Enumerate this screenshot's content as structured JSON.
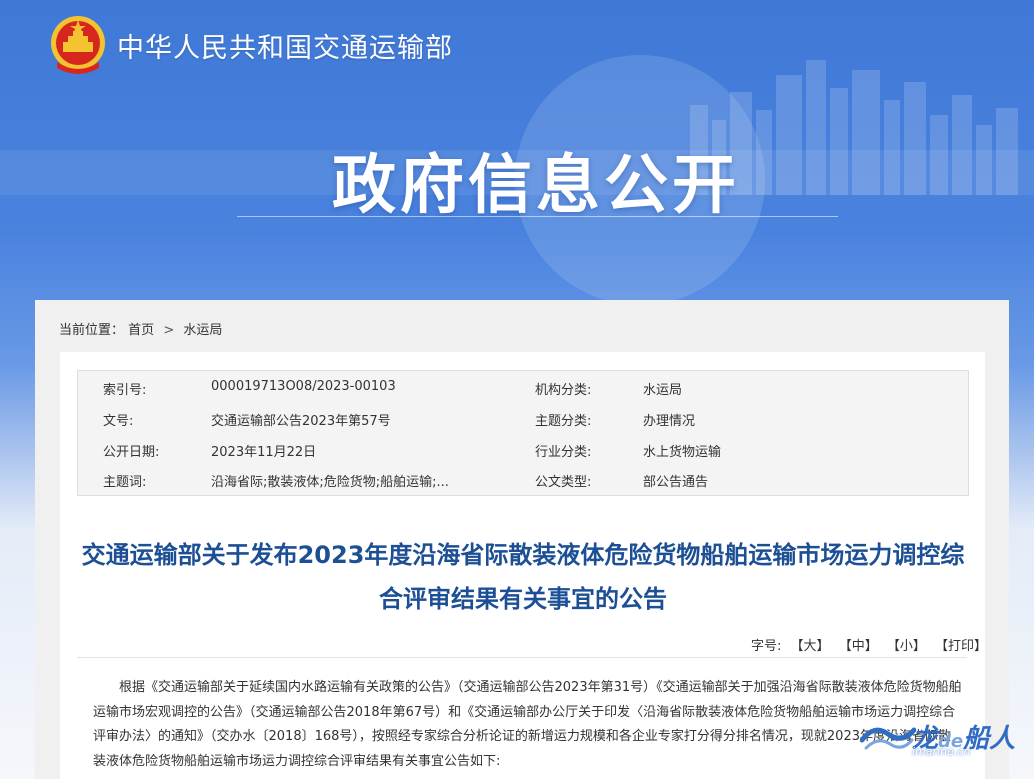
{
  "header": {
    "ministry_name": "中华人民共和国交通运输部",
    "hero_title": "政府信息公开"
  },
  "breadcrumb": {
    "label": "当前位置：",
    "items": [
      "首页",
      "水运局"
    ],
    "separator": ">"
  },
  "meta": {
    "index_no_label": "索引号:",
    "index_no": "000019713O08/2023-00103",
    "org_category_label": "机构分类:",
    "org_category": "水运局",
    "doc_no_label": "文号:",
    "doc_no": "交通运输部公告2023年第57号",
    "topic_category_label": "主题分类:",
    "topic_category": "办理情况",
    "publish_date_label": "公开日期:",
    "publish_date": "2023年11月22日",
    "industry_category_label": "行业分类:",
    "industry_category": "水上货物运输",
    "keywords_label": "主题词:",
    "keywords": "沿海省际;散装液体;危险货物;船舶运输;...",
    "doc_type_label": "公文类型:",
    "doc_type": "部公告通告"
  },
  "document": {
    "title": "交通运输部关于发布2023年度沿海省际散装液体危险货物船舶运输市场运力调控综合评审结果有关事宜的公告",
    "font_size_label": "字号:",
    "font_large": "【大】",
    "font_medium": "【中】",
    "font_small": "【小】",
    "print": "【打印】",
    "body": "根据《交通运输部关于延续国内水路运输有关政策的公告》（交通运输部公告2023年第31号）《交通运输部关于加强沿海省际散装液体危险货物船舶运输市场宏观调控的公告》（交通运输部公告2018年第67号）和《交通运输部办公厅关于印发〈沿海省际散装液体危险货物船舶运输市场运力调控综合评审办法〉的通知》（交办水〔2018〕168号），按照经专家综合分析论证的新增运力规模和各企业专家打分得分排名情况，现就2023年度沿海省际散装液体危险货物船舶运输市场运力调控综合评审结果有关事宜公告如下:"
  },
  "watermark": {
    "brand_a": "龙",
    "brand_de": "de",
    "brand_b": "船人",
    "url": "imarine.cn"
  },
  "colors": {
    "banner_blue": "#3f78d6",
    "title_blue": "#1d4f95",
    "emblem_red": "#d7261e",
    "emblem_gold": "#f4c430"
  }
}
